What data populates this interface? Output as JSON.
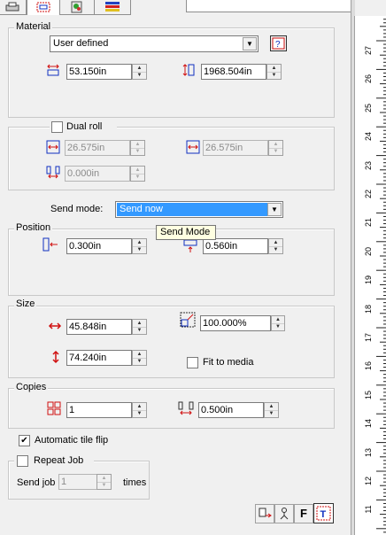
{
  "material": {
    "group_label": "Material",
    "type_value": "User defined",
    "width_value": "53.150in",
    "length_value": "1968.504in"
  },
  "dual_roll": {
    "label": "Dual roll",
    "checked": false,
    "roll1_value": "26.575in",
    "roll2_value": "26.575in",
    "gap_value": "0.000in"
  },
  "send_mode": {
    "label": "Send mode:",
    "value": "Send now",
    "tooltip": "Send Mode"
  },
  "position": {
    "group_label": "Position",
    "x_value": "0.300in",
    "y_value": "0.560in"
  },
  "size": {
    "group_label": "Size",
    "width_value": "45.848in",
    "height_value": "74.240in",
    "scale_value": "100.000%",
    "fit_label": "Fit to media",
    "fit_checked": false
  },
  "copies": {
    "group_label": "Copies",
    "count_value": "1",
    "spacing_value": "0.500in"
  },
  "auto_tile_flip": {
    "label": "Automatic tile flip",
    "checked": true
  },
  "repeat_job": {
    "label": "Repeat Job",
    "checked": false,
    "send_job_label": "Send job",
    "count_value": "1",
    "times_label": "times"
  },
  "bottom_toolbar": {
    "f_label": "F"
  },
  "ruler": {
    "labels": [
      "27",
      "26",
      "25",
      "24",
      "23",
      "22",
      "21",
      "20",
      "19",
      "18",
      "17",
      "16",
      "15",
      "14",
      "13",
      "12",
      "11"
    ]
  },
  "colors": {
    "selection": "#3399ff",
    "icon_red": "#d01010",
    "icon_blue": "#1030c0"
  }
}
